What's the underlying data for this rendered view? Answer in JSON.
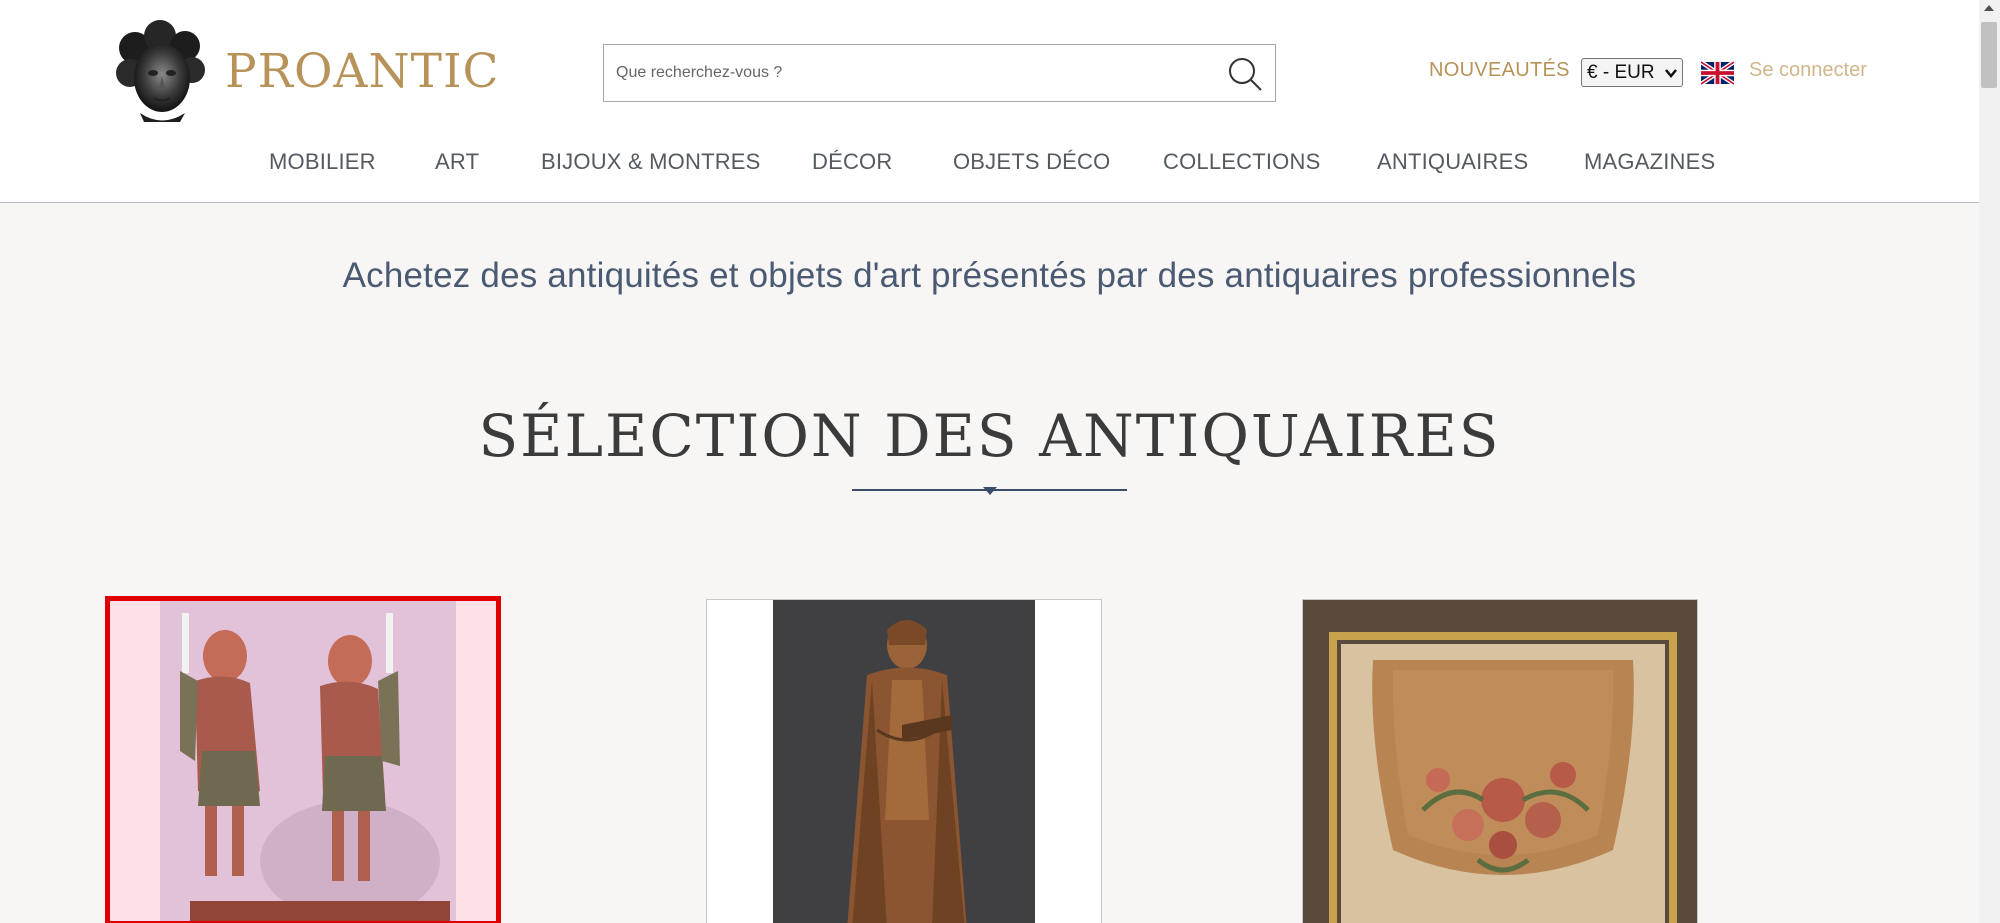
{
  "brand": {
    "name": "PROANTIC"
  },
  "search": {
    "placeholder": "Que recherchez-vous ?",
    "value": ""
  },
  "header": {
    "new_label": "NOUVEAUTÉS",
    "currency": "€ - EUR",
    "language_flag": "uk-flag-icon",
    "login_label": "Se connecter"
  },
  "nav": [
    {
      "label": "MOBILIER"
    },
    {
      "label": "ART"
    },
    {
      "label": "BIJOUX & MONTRES"
    },
    {
      "label": "DÉCOR"
    },
    {
      "label": "OBJETS DÉCO"
    },
    {
      "label": "COLLECTIONS"
    },
    {
      "label": "ANTIQUAIRES"
    },
    {
      "label": "MAGAZINES"
    }
  ],
  "main": {
    "tagline": "Achetez des antiquités et objets d'art présentés par des antiquaires professionnels",
    "section_title": "SÉLECTION DES ANTIQUAIRES"
  },
  "products": [
    {
      "image": "pair-of-carved-angel-candle-bearers-image",
      "selected": true
    },
    {
      "image": "carved-wooden-saint-statue-image",
      "selected": false
    },
    {
      "image": "framed-floral-tapestry-image",
      "selected": false
    }
  ],
  "colors": {
    "brand_gold": "#b7935a",
    "login_gold": "#cfb68b",
    "tagline_blue": "#4a5a73",
    "selection_red": "#e00000",
    "background": "#f7f6f4"
  }
}
